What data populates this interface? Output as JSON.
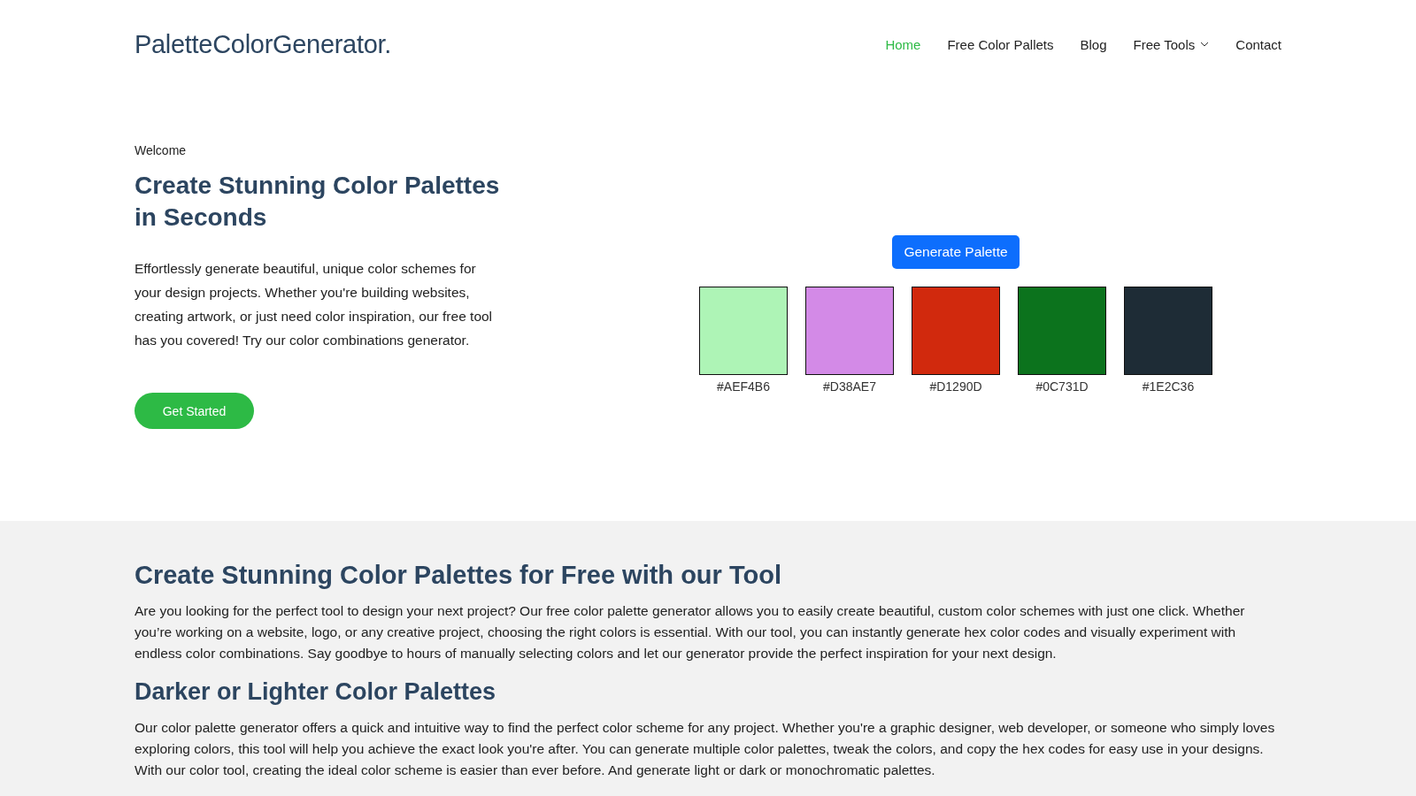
{
  "header": {
    "logo": "PaletteColorGenerator.",
    "nav": [
      {
        "label": "Home",
        "selected": true,
        "dropdown": false
      },
      {
        "label": "Free Color Pallets",
        "selected": false,
        "dropdown": false
      },
      {
        "label": "Blog",
        "selected": false,
        "dropdown": false
      },
      {
        "label": "Free Tools",
        "selected": false,
        "dropdown": true
      },
      {
        "label": "Contact",
        "selected": false,
        "dropdown": false
      }
    ]
  },
  "hero": {
    "eyebrow": "Welcome",
    "title": "Create Stunning Color Palettes in Seconds",
    "text": "Effortlessly generate beautiful, unique color schemes for your design projects. Whether you're building websites, creating artwork, or just need color inspiration, our free tool has you covered! Try our color combinations generator.",
    "cta": "Get Started"
  },
  "generator": {
    "button": "Generate Palette",
    "swatches": [
      {
        "label": "#AEF4B6",
        "color": "#aef4b6"
      },
      {
        "label": "#D38AE7",
        "color": "#d38ae7"
      },
      {
        "label": "#D1290D",
        "color": "#d1290d"
      },
      {
        "label": "#0C731D",
        "color": "#0c731d"
      },
      {
        "label": "#1E2C36",
        "color": "#1e2c36"
      }
    ]
  },
  "sections": [
    {
      "heading": "Create Stunning Color Palettes for Free with our Tool",
      "text": "Are you looking for the perfect tool to design your next project? Our free color palette generator allows you to easily create beautiful, custom color schemes with just one click. Whether you’re working on a website, logo, or any creative project, choosing the right colors is essential. With our tool, you can instantly generate hex color codes and visually experiment with endless color combinations. Say goodbye to hours of manually selecting colors and let our generator provide the perfect inspiration for your next design."
    },
    {
      "heading": "Darker or Lighter Color Palettes",
      "text": "Our color palette generator offers a quick and intuitive way to find the perfect color scheme for any project. Whether you're a graphic designer, web developer, or someone who simply loves exploring colors, this tool will help you achieve the exact look you're after. You can generate multiple color palettes, tweak the colors, and copy the hex codes for easy use in your designs. With our color tool, creating the ideal color scheme is easier than ever before. And generate light or dark or monochromatic palettes."
    }
  ]
}
